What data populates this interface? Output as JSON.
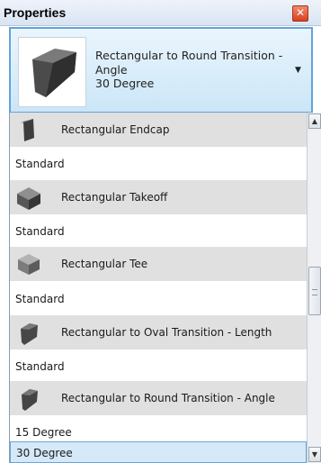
{
  "palette": {
    "title_gradient": "#d9e4f2",
    "selector_border": "#63a3d9",
    "group_header_bg": "#e0e0e0",
    "selected_bg": "#d5e9f8",
    "close_red": "#d6411f"
  },
  "panel": {
    "title": "Properties",
    "close_icon": "close-icon"
  },
  "type_selector": {
    "family": "Rectangular to Round Transition -",
    "family_cont": "Angle",
    "type": "30 Degree",
    "dropdown_icon": "chevron-down-icon"
  },
  "groups": [
    {
      "family": "Rectangular Endcap",
      "icon": "endcap-icon",
      "types": [
        "Standard"
      ]
    },
    {
      "family": "Rectangular Takeoff",
      "icon": "takeoff-icon",
      "types": [
        "Standard"
      ]
    },
    {
      "family": "Rectangular Tee",
      "icon": "tee-icon",
      "types": [
        "Standard"
      ]
    },
    {
      "family": "Rectangular to Oval Transition - Length",
      "icon": "oval-transition-icon",
      "types": [
        "Standard"
      ]
    },
    {
      "family": "Rectangular to Round Transition - Angle",
      "icon": "round-transition-icon",
      "types": [
        "15 Degree",
        "30 Degree"
      ],
      "selected": "30 Degree"
    }
  ],
  "scrollbar": {
    "up_icon": "scroll-up-icon",
    "down_icon": "scroll-down-icon",
    "position": 0.58
  }
}
